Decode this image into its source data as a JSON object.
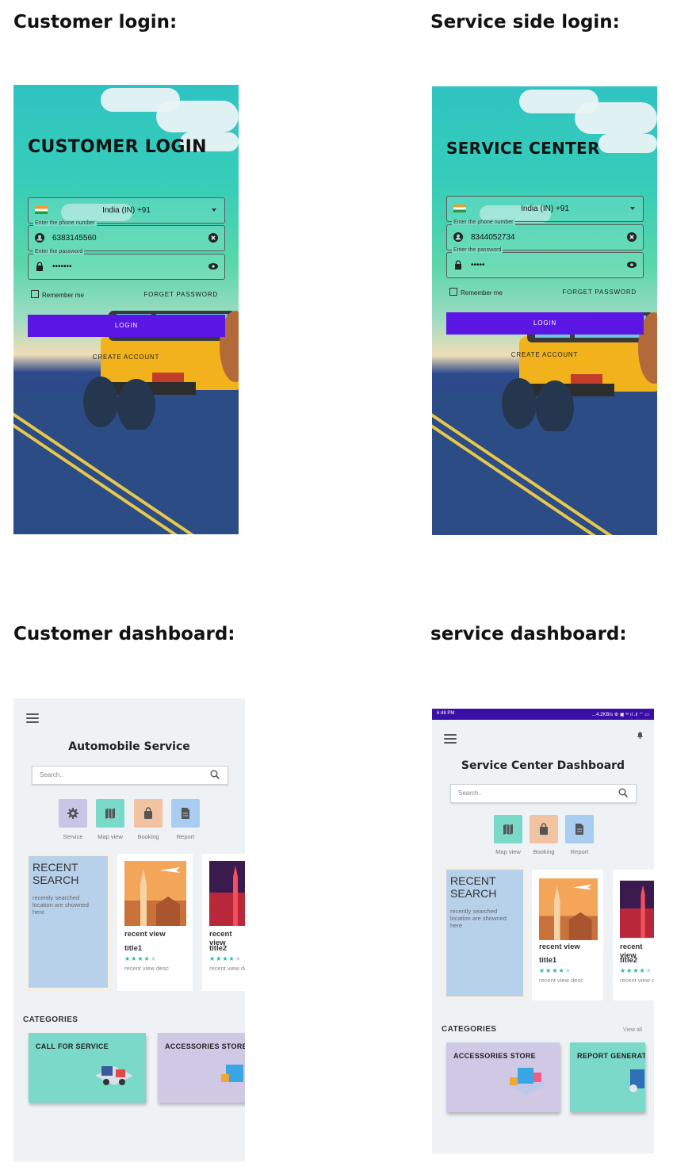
{
  "headings": {
    "customer_login": "Customer login:",
    "service_login": "Service side login:",
    "customer_dashboard": "Customer dashboard:",
    "service_dashboard": "service dashboard:"
  },
  "customer_login": {
    "title": "CUSTOMER LOGIN",
    "country": "India (IN)  +91",
    "phone_label": "Enter the phone number",
    "phone_value": "6383145560",
    "password_label": "Enter the password",
    "password_value": "•••••••",
    "remember": "Remember me",
    "forgot": "FORGET PASSWORD",
    "login": "LOGIN",
    "create": "CREATE ACCOUNT"
  },
  "service_login": {
    "title": "SERVICE CENTER",
    "country": "India (IN)  +91",
    "phone_label": "Enter the phone number",
    "phone_value": "8344052734",
    "password_label": "Enter the password",
    "password_value": "•••••",
    "remember": "Remember me",
    "forgot": "FORGET PASSWORD",
    "login": "LOGIN",
    "create": "CREATE ACCOUNT"
  },
  "customer_dashboard": {
    "title": "Automobile Service",
    "search_placeholder": "Search..",
    "tiles": [
      {
        "label": "Service",
        "color": "#c9c5e6",
        "icon": "gear-icon"
      },
      {
        "label": "Map view",
        "color": "#7ad9c9",
        "icon": "map-icon"
      },
      {
        "label": "Booking",
        "color": "#f2c3a2",
        "icon": "bag-icon"
      },
      {
        "label": "Report",
        "color": "#a9cdf0",
        "icon": "document-icon"
      }
    ],
    "recent": {
      "heading": "RECENT SEARCH",
      "sub": "recently searched location are showned here"
    },
    "cards": [
      {
        "t1": "recent view",
        "t2": "title1",
        "desc": "recent view desc"
      },
      {
        "t1": "recent view",
        "t2": "title2",
        "desc": "recent view desc"
      }
    ],
    "categories_heading": "CATEGORIES",
    "categories": [
      {
        "label": "CALL FOR SERVICE",
        "color": "#7ad9c9"
      },
      {
        "label": "ACCESSORIES STORE",
        "color": "#cfc9e6"
      }
    ]
  },
  "service_dashboard": {
    "status_time": "6:48 PM",
    "status_right": "...4.2KB/s ⚙ ▣ ᵛᵒ ıl .ıl ⌔ ▭",
    "title": "Service Center Dashboard",
    "search_placeholder": "Search..",
    "tiles": [
      {
        "label": "Map view",
        "color": "#7ad9c9",
        "icon": "map-icon"
      },
      {
        "label": "Booking",
        "color": "#f2c3a2",
        "icon": "bag-icon"
      },
      {
        "label": "Report",
        "color": "#a9cdf0",
        "icon": "document-icon"
      }
    ],
    "recent": {
      "heading": "RECENT SEARCH",
      "sub": "recently searched location are showned here"
    },
    "cards": [
      {
        "t1": "recent view",
        "t2": "title1",
        "desc": "recent view desc"
      },
      {
        "t1": "recent view",
        "t2": "title2",
        "desc": "recent view desc"
      }
    ],
    "categories_heading": "CATEGORIES",
    "view_all": "View all",
    "categories": [
      {
        "label": "ACCESSORIES STORE",
        "color": "#cfc9e6"
      },
      {
        "label": "REPORT GENERATION",
        "color": "#7ad9c9"
      }
    ]
  }
}
